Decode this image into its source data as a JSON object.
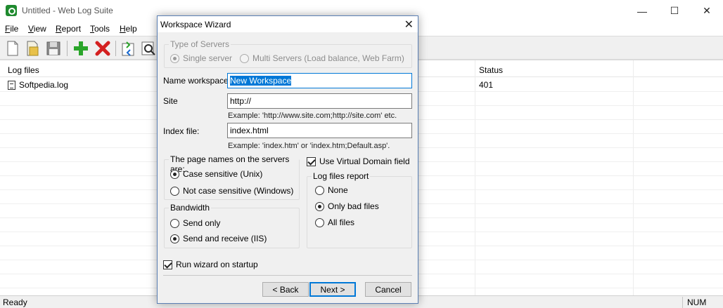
{
  "app": {
    "title": "Untitled - Web Log Suite",
    "icon": "globe-app-icon"
  },
  "window_controls": {
    "minimize": "—",
    "maximize": "☐",
    "close": "✕"
  },
  "menu": [
    {
      "label": "File",
      "key": "F",
      "rest": "ile"
    },
    {
      "label": "View",
      "key": "V",
      "rest": "iew"
    },
    {
      "label": "Report",
      "key": "R",
      "rest": "eport"
    },
    {
      "label": "Tools",
      "key": "T",
      "rest": "ools"
    },
    {
      "label": "Help",
      "key": "H",
      "rest": "elp"
    }
  ],
  "toolbar": {
    "buttons": [
      "new-document-icon",
      "open-folder-icon",
      "save-disk-icon",
      "add-plus-icon",
      "delete-x-icon",
      "refresh-icon",
      "search-magnifier-icon"
    ]
  },
  "list": {
    "headers": {
      "log_files": "Log files",
      "status": "Status"
    },
    "rows": [
      {
        "file": "Softpedia.log",
        "status": "401"
      }
    ]
  },
  "statusbar": {
    "text": "Ready",
    "num": "NUM"
  },
  "dialog": {
    "title": "Workspace Wizard",
    "type_of_servers": {
      "label": "Type of Servers",
      "single": "Single server",
      "multi": "Multi Servers (Load balance, Web Farm)",
      "selected": "single"
    },
    "name_workspace": {
      "label": "Name workspace:",
      "value": "New Workspace"
    },
    "site": {
      "label": "Site",
      "value": "http://",
      "example": "Example: 'http://www.site.com;http://site.com' etc."
    },
    "index_file": {
      "label": "Index file:",
      "value": "index.html",
      "example": "Example: 'index.htm' or 'index.htm;Default.asp'."
    },
    "page_names": {
      "label": "The page names on the servers are:",
      "case_sensitive": "Case sensitive (Unix)",
      "not_case_sensitive": "Not case sensitive (Windows)",
      "selected": "case_sensitive"
    },
    "use_virtual_domain": {
      "label": "Use Virtual Domain field",
      "checked": true
    },
    "log_files_report": {
      "label": "Log files report",
      "none": "None",
      "only_bad": "Only bad files",
      "all": "All files",
      "selected": "only_bad"
    },
    "bandwidth": {
      "label": "Bandwidth",
      "send_only": "Send only",
      "send_receive": "Send and receive (IIS)",
      "selected": "send_receive"
    },
    "run_wizard": {
      "label": "Run wizard on startup",
      "checked": true
    },
    "buttons": {
      "back": "< Back",
      "next": "Next >",
      "cancel": "Cancel"
    }
  },
  "colors": {
    "accent": "#0078d7",
    "dialog_bg": "#f0f0f0",
    "add_green": "#2aa52a",
    "delete_red": "#d42020"
  }
}
